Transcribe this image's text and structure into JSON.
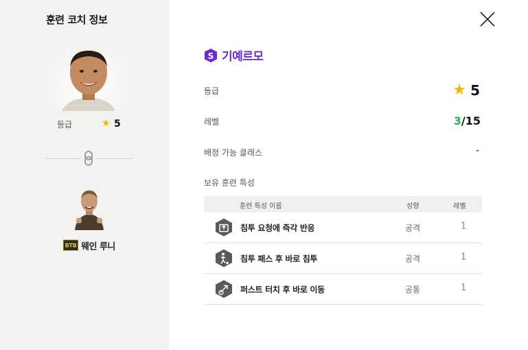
{
  "left_panel": {
    "title": "훈련 코치 정보",
    "grade_label": "등급",
    "grade_value": "5",
    "linked_player": {
      "badge": "BTB",
      "name": "웨인 루니"
    }
  },
  "coach": {
    "name": "기예르모",
    "grade_label": "등급",
    "grade_value": "5",
    "level_label": "레벨",
    "level_current": "3",
    "level_max": "/15",
    "class_label": "배정 가능 클래스",
    "class_value": "-",
    "traits_label": "보유 훈련 특성"
  },
  "traits_table": {
    "headers": {
      "name": "훈련 특성 이름",
      "type": "성향",
      "level": "레벨"
    },
    "rows": [
      {
        "icon": "run-up-icon",
        "name": "침투 요청에 즉각 반응",
        "type": "공격",
        "level": "1"
      },
      {
        "icon": "pass-run-icon",
        "name": "침투 패스 후 바로 침투",
        "type": "공격",
        "level": "1"
      },
      {
        "icon": "first-touch-icon",
        "name": "퍼스트 터치 후 바로 이동",
        "type": "공통",
        "level": "1"
      }
    ]
  },
  "colors": {
    "accent_purple": "#6a2bd6",
    "star_gold": "#f1b800",
    "level_green": "#22b35a",
    "left_bg": "#f2f2f0"
  }
}
